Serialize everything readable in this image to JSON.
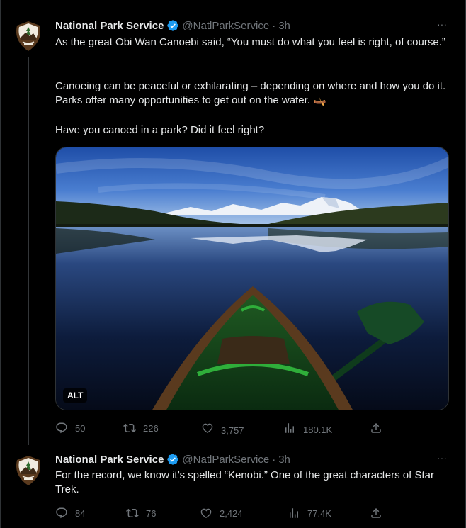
{
  "tweets": [
    {
      "author_name": "National Park Service",
      "handle": "@NatlParkService",
      "time": "3h",
      "more_label": "···",
      "text_1": "As the great Obi Wan Canoebi said, “You must do what you feel is right, of course.”",
      "text_2": "Canoeing can be peaceful or exhilarating – depending on where and how you do it. Parks offer many opportunities to get out on the water. 🛶",
      "text_3": "Have you canoed in a park? Did it feel right?",
      "media_alt_label": "ALT",
      "replies": "50",
      "retweets": "226",
      "likes": "3,757",
      "views": "180.1K"
    },
    {
      "author_name": "National Park Service",
      "handle": "@NatlParkService",
      "time": "3h",
      "more_label": "···",
      "text": "For the record, we know it’s spelled “Kenobi.” One of the great characters of Star Trek.",
      "replies": "84",
      "retweets": "76",
      "likes": "2,424",
      "views": "77.4K"
    }
  ],
  "icons": {
    "avatar": "nps-arrowhead-logo",
    "verified": "verified-badge-icon",
    "reply": "reply-icon",
    "retweet": "retweet-icon",
    "like": "heart-icon",
    "views": "views-chart-icon",
    "share": "share-icon"
  },
  "colors": {
    "background": "#000000",
    "text": "#e7e9ea",
    "secondary": "#71767b",
    "verified": "#1d9bf0",
    "nps_brown": "#5a3a1e"
  }
}
